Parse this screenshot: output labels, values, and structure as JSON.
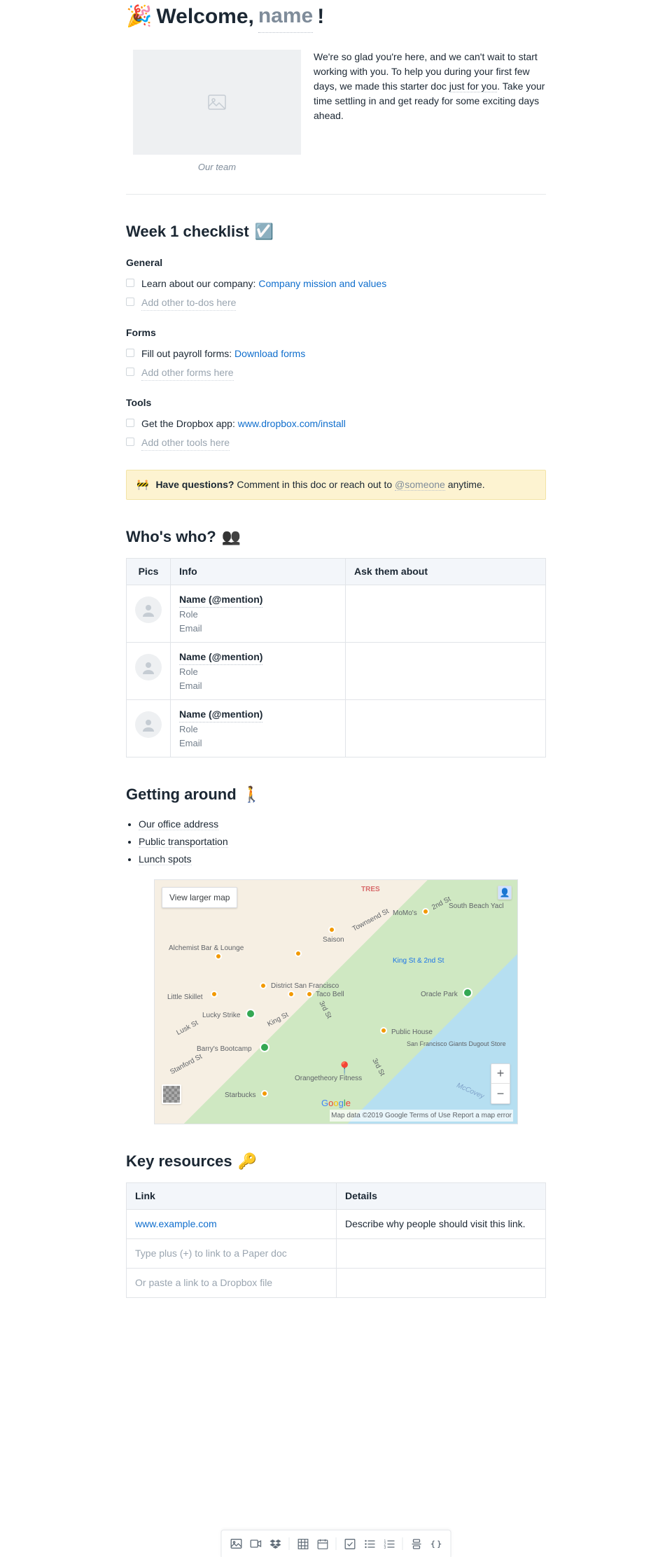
{
  "header": {
    "emoji": "🎉",
    "prefix": "Welcome, ",
    "name_placeholder": "name",
    "suffix": "!"
  },
  "intro": {
    "image_caption": "Our team",
    "text_1": "We're so glad you're here, and we can't wait to start working with you. To help you during your first few days, we made this starter doc ",
    "text_underlined": "just for you",
    "text_2": ". Take your time settling in and get ready for some exciting days ahead."
  },
  "checklist": {
    "heading": "Week 1 checklist",
    "emoji": "☑️",
    "sections": [
      {
        "title": "General",
        "items": [
          {
            "text": "Learn about our company: ",
            "link": "Company mission and values",
            "placeholder": false
          },
          {
            "text": "Add other to-dos here",
            "link": null,
            "placeholder": true
          }
        ]
      },
      {
        "title": "Forms",
        "items": [
          {
            "text": "Fill out payroll forms: ",
            "link": "Download forms",
            "placeholder": false
          },
          {
            "text": "Add other forms here",
            "link": null,
            "placeholder": true
          }
        ]
      },
      {
        "title": "Tools",
        "items": [
          {
            "text": "Get the Dropbox app: ",
            "link": "www.dropbox.com/install",
            "placeholder": false
          },
          {
            "text": "Add other tools here",
            "link": null,
            "placeholder": true
          }
        ]
      }
    ]
  },
  "callout": {
    "emoji": "🚧",
    "bold": "Have questions?",
    "text_1": " Comment in this doc or reach out to ",
    "mention": "@someone",
    "text_2": " anytime."
  },
  "whoswho": {
    "heading": "Who's who?",
    "emoji": "👥",
    "columns": [
      "Pics",
      "Info",
      "Ask them about"
    ],
    "rows": [
      {
        "name": "Name (@mention)",
        "role": "Role",
        "email": "Email",
        "ask": ""
      },
      {
        "name": "Name (@mention)",
        "role": "Role",
        "email": "Email",
        "ask": ""
      },
      {
        "name": "Name (@mention)",
        "role": "Role",
        "email": "Email",
        "ask": ""
      }
    ]
  },
  "getting_around": {
    "heading": "Getting around",
    "emoji": "🚶",
    "bullets": [
      "Our office address",
      "Public transportation",
      "Lunch spots"
    ]
  },
  "map": {
    "view_larger": "View larger map",
    "footer": "Map data ©2019 Google  Terms of Use  Report a map error",
    "labels": {
      "tres": "TRES",
      "momos": "MoMo's",
      "south_beach": "South Beach Yacl",
      "saison": "Saison",
      "alchemist": "Alchemist Bar & Lounge",
      "king_2nd": "King St & 2nd St",
      "district": "District San Francisco",
      "little_skillet": "Little Skillet",
      "taco_bell": "Taco Bell",
      "oracle_park": "Oracle Park",
      "lucky_strike": "Lucky Strike",
      "public_house": "Public House",
      "dugout": "San Francisco Giants Dugout Store",
      "barrys": "Barry's Bootcamp",
      "orangetheory": "Orangetheory Fitness",
      "starbucks": "Starbucks",
      "townsend": "Townsend St",
      "king_st": "King St",
      "second": "2nd St",
      "third": "3rd St",
      "third2": "3rd St",
      "lusk": "Lusk St",
      "stanford": "Stanford St",
      "mccovey": "McCovey"
    }
  },
  "resources": {
    "heading": "Key resources",
    "emoji": "🔑",
    "columns": [
      "Link",
      "Details"
    ],
    "rows": [
      {
        "link": "www.example.com",
        "details": "Describe why people should visit this link.",
        "is_link": true
      },
      {
        "link": "Type plus (+) to link to a Paper doc",
        "details": "",
        "is_link": false
      },
      {
        "link": "Or paste a link to a Dropbox file",
        "details": "",
        "is_link": false
      }
    ]
  },
  "toolbar": {
    "items": [
      "image",
      "video",
      "dropbox",
      "sep",
      "table",
      "calendar",
      "sep",
      "checkbox",
      "bullet-list",
      "numbered-list",
      "sep",
      "divider",
      "code"
    ]
  }
}
